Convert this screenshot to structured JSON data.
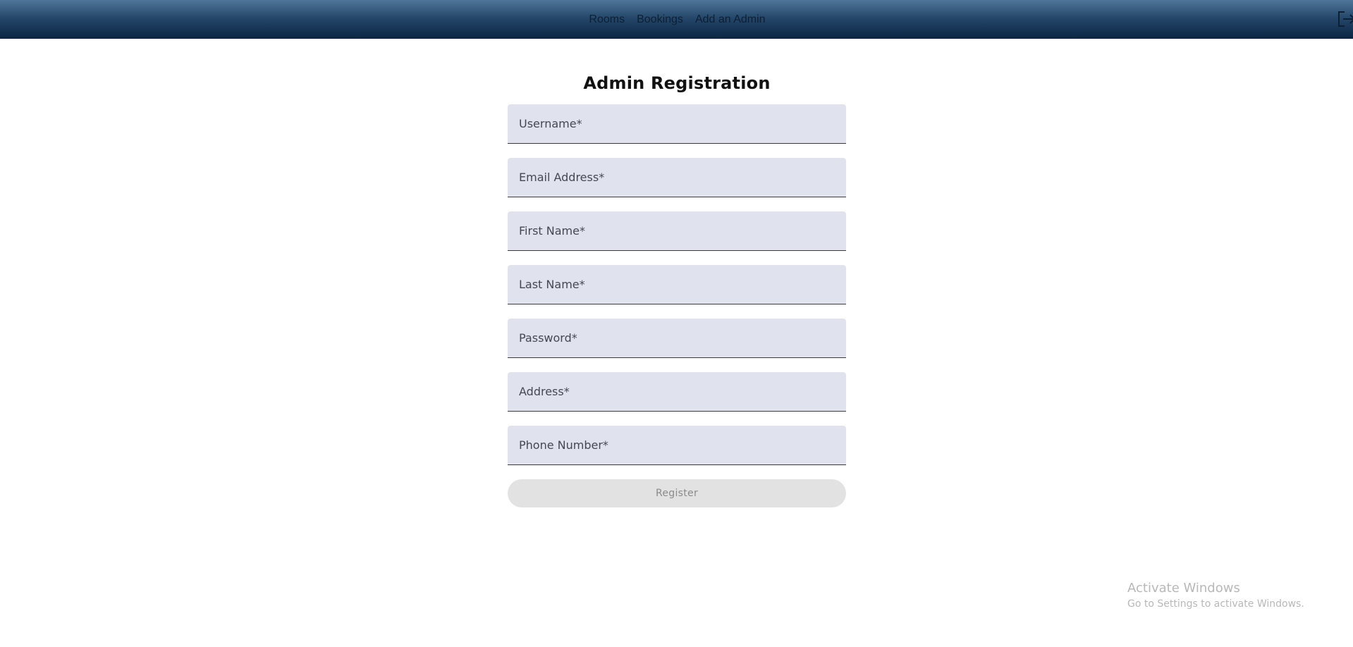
{
  "navbar": {
    "links": [
      {
        "label": "Rooms"
      },
      {
        "label": "Bookings"
      },
      {
        "label": "Add an Admin"
      }
    ],
    "logout_icon": "logout-icon"
  },
  "form": {
    "title": "Admin Registration",
    "fields": [
      {
        "placeholder": "Username*",
        "value": ""
      },
      {
        "placeholder": "Email Address*",
        "value": ""
      },
      {
        "placeholder": "First Name*",
        "value": ""
      },
      {
        "placeholder": "Last Name*",
        "value": ""
      },
      {
        "placeholder": "Password*",
        "value": ""
      },
      {
        "placeholder": "Address*",
        "value": ""
      },
      {
        "placeholder": "Phone Number*",
        "value": ""
      }
    ],
    "register_label": "Register"
  },
  "watermark": {
    "title": "Activate Windows",
    "subtitle": "Go to Settings to activate Windows."
  },
  "colors": {
    "navbar_top": "#4f7698",
    "navbar_bottom": "#0b2442",
    "field_bg": "#e0e3ee",
    "button_bg": "#e2e2e2"
  }
}
